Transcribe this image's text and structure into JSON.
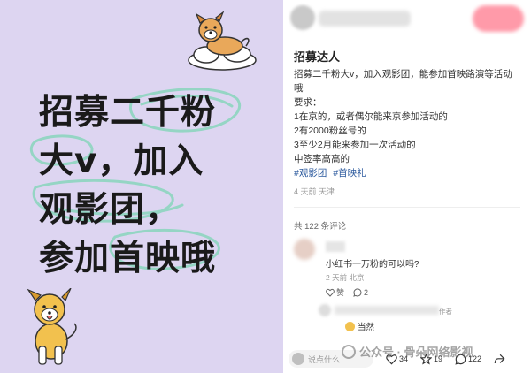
{
  "poster": {
    "lines": [
      "招募二千粉",
      "大v，加入",
      "观影团，",
      "参加首映哦"
    ]
  },
  "post": {
    "title": "招募达人",
    "body": [
      "招募二千粉大v，加入观影团，能参加首映路演等活动",
      "哦",
      "要求：",
      "1在京的，或者偶尔能来京参加活动的",
      "2有2000粉丝号的",
      "3至少2月能来参加一次活动的",
      "中签率高高的"
    ],
    "tags": [
      "#观影团",
      "#首映礼"
    ],
    "meta": "4 天前 天津",
    "comment_count": "共 122 条评论"
  },
  "comments": [
    {
      "text": "小红书一万粉的可以吗?",
      "meta": "2 天前 北京",
      "like_label": "赞",
      "reply_count": "2"
    },
    {
      "author_badge": "作者",
      "text": "当然"
    }
  ],
  "bottom_bar": {
    "input_placeholder": "说点什么...",
    "likes": "34",
    "stars": "19",
    "comments": "122"
  },
  "watermark": "公众号 · 骨朵网络影视",
  "colors": {
    "poster_bg": "#ddd5f1",
    "scribble": "#8ed6c0",
    "tag": "#2c5a9e"
  }
}
